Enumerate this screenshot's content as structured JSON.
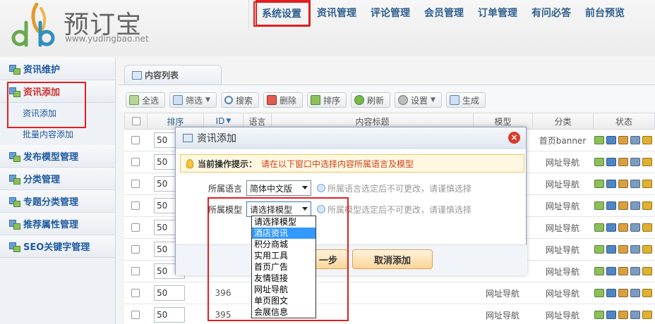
{
  "header": {
    "brand_name": "预订宝",
    "brand_url": "www.yudingbao.net",
    "nav": [
      "系统设置",
      "资讯管理",
      "评论管理",
      "会员管理",
      "订单管理",
      "有问必答",
      "前台预览"
    ]
  },
  "sidebar": {
    "groups": [
      {
        "label": "资讯维护"
      },
      {
        "label": "资讯添加",
        "subs": [
          "资讯添加",
          "批量内容添加"
        ]
      },
      {
        "label": "发布模型管理"
      },
      {
        "label": "分类管理"
      },
      {
        "label": "专题分类管理"
      },
      {
        "label": "推荐属性管理"
      },
      {
        "label": "SEO关键字管理"
      }
    ]
  },
  "content": {
    "tab": "内容列表",
    "toolbar": [
      "全选",
      "筛选",
      "搜索",
      "删除",
      "排序",
      "刷新",
      "设置",
      "生成"
    ],
    "columns": [
      "排序",
      "ID",
      "语言",
      "内容标题",
      "模型",
      "分类",
      "状态"
    ],
    "rows": [
      {
        "sort": "50",
        "id": "",
        "model": "",
        "category": "首页banner"
      },
      {
        "sort": "50",
        "id": "",
        "model": "",
        "category": "网址导航"
      },
      {
        "sort": "50",
        "id": "",
        "model": "",
        "category": "网址导航"
      },
      {
        "sort": "50",
        "id": "",
        "model": "",
        "category": "网址导航"
      },
      {
        "sort": "50",
        "id": "",
        "model": "",
        "category": "网址导航"
      },
      {
        "sort": "50",
        "id": "",
        "model": "",
        "category": "网址导航"
      },
      {
        "sort": "50",
        "id": "",
        "model": "",
        "category": "网址导航"
      },
      {
        "sort": "50",
        "id": "396",
        "model": "网址导航",
        "category": "网址导航"
      },
      {
        "sort": "50",
        "id": "395",
        "model": "网址导航",
        "category": "网址导航"
      }
    ]
  },
  "dialog": {
    "title": "资讯添加",
    "tip_label": "当前操作提示：",
    "tip_text": "请在以下窗口中选择内容所属语言及模型",
    "lang_label": "所属语言",
    "lang_value": "简体中文版",
    "lang_hint": "所属语言选定后不可更改，请谨慎选择",
    "model_label": "所属模型",
    "model_value": "请选择模型",
    "model_hint": "所属模型选定后不可更改，请谨慎选择",
    "next_button": "一步",
    "cancel_button": "取消添加"
  },
  "dropdown": {
    "options": [
      "请选择模型",
      "酒店资讯",
      "积分商城",
      "实用工具",
      "首页广告",
      "友情链接",
      "网址导航",
      "单页图文",
      "会展信息"
    ],
    "highlighted_index": 1
  },
  "colors": {
    "nav_text": "#2f5f8f",
    "highlight_red": "#e02020",
    "tip_text": "#d0401a",
    "dropdown_highlight": "#3399ff"
  }
}
